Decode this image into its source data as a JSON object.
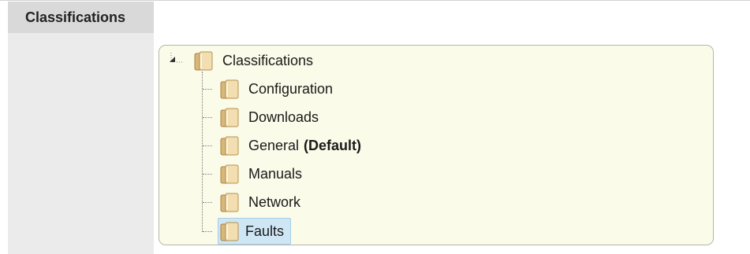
{
  "section": {
    "label": "Classifications"
  },
  "tree": {
    "root": {
      "label": "Classifications",
      "icon": "folder-icon",
      "expanded": true
    },
    "items": [
      {
        "label": "Configuration",
        "icon": "folder-icon"
      },
      {
        "label": "Downloads",
        "icon": "folder-icon"
      },
      {
        "label": "General",
        "suffix": "(Default)",
        "icon": "folder-icon"
      },
      {
        "label": "Manuals",
        "icon": "folder-icon"
      },
      {
        "label": "Network",
        "icon": "folder-icon"
      },
      {
        "label": "Faults",
        "icon": "folder-icon",
        "selected": true
      }
    ],
    "colors": {
      "panel_bg": "#fbfbea",
      "selection": "#cfe6f5",
      "label_column": "#ebebeb",
      "label_header": "#d9d9d9"
    }
  }
}
